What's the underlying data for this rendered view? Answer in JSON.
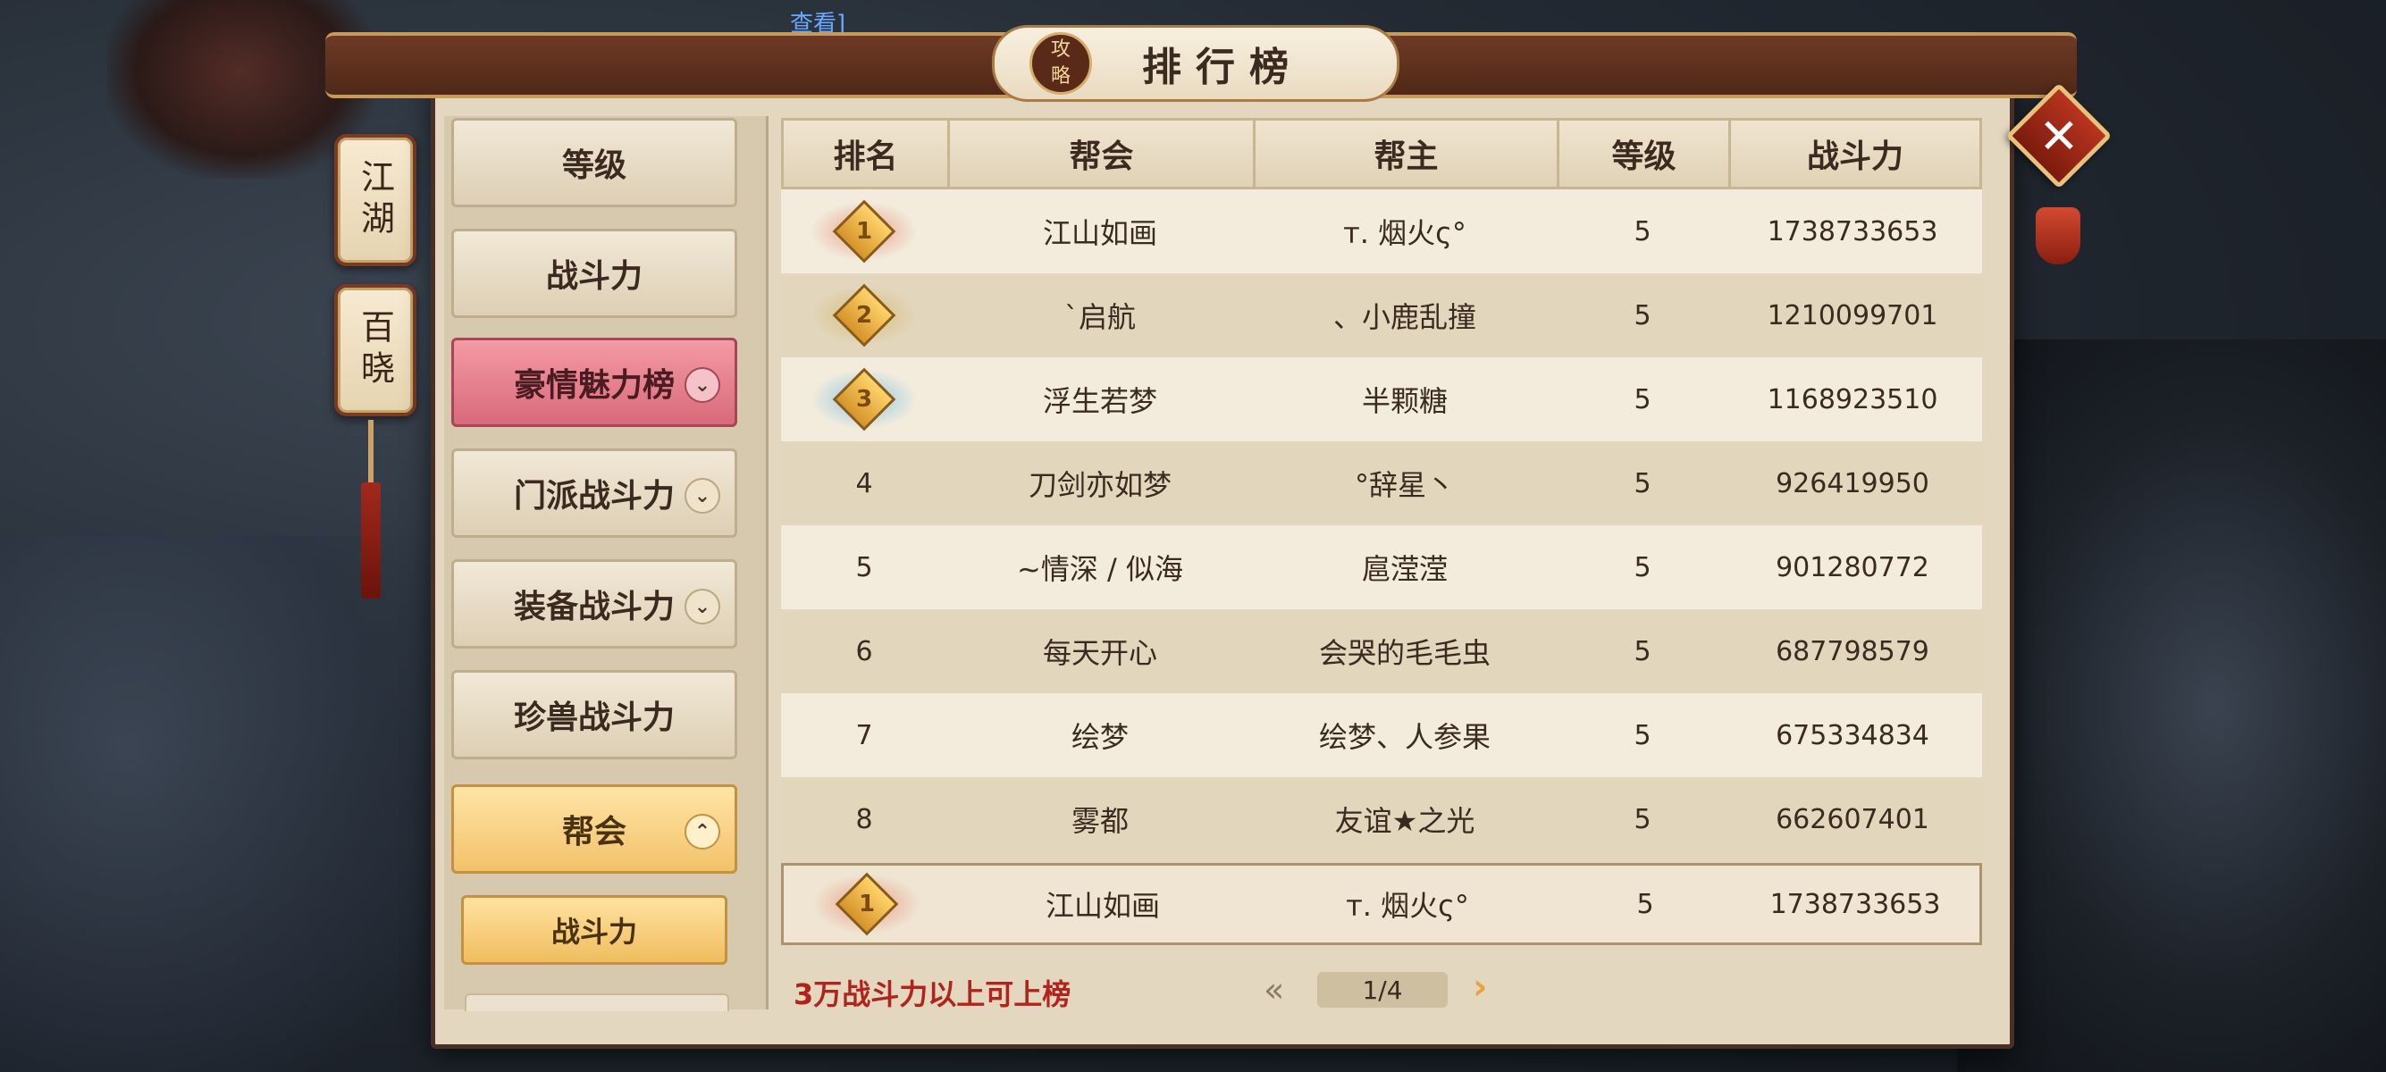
{
  "top_link": "查看]",
  "side_tabs": [
    "江湖",
    "百晓"
  ],
  "title": "排行榜",
  "title_seal": [
    "攻",
    "略"
  ],
  "close_label": "✕",
  "menu": [
    {
      "label": "等级",
      "style": "normal",
      "chevron": ""
    },
    {
      "label": "战斗力",
      "style": "normal",
      "chevron": ""
    },
    {
      "label": "豪情魅力榜",
      "style": "pink",
      "chevron": "⌄"
    },
    {
      "label": "门派战斗力",
      "style": "normal",
      "chevron": "⌄"
    },
    {
      "label": "装备战斗力",
      "style": "normal",
      "chevron": "⌄"
    },
    {
      "label": "珍兽战斗力",
      "style": "normal",
      "chevron": ""
    },
    {
      "label": "帮会",
      "style": "gold",
      "chevron": "⌃"
    }
  ],
  "submenu_selected": "战斗力",
  "table": {
    "headers": [
      "排名",
      "帮会",
      "帮主",
      "等级",
      "战斗力"
    ],
    "rows": [
      {
        "rank": "1",
        "guild": "江山如画",
        "leader": "т. 烟火ς°",
        "level": "5",
        "power": "1738733653"
      },
      {
        "rank": "2",
        "guild": "`启航",
        "leader": "、小鹿乱撞",
        "level": "5",
        "power": "1210099701"
      },
      {
        "rank": "3",
        "guild": "浮生若梦",
        "leader": "半颗糖",
        "level": "5",
        "power": "1168923510"
      },
      {
        "rank": "4",
        "guild": "刀剑亦如梦",
        "leader": "°辞星丶",
        "level": "5",
        "power": "926419950"
      },
      {
        "rank": "5",
        "guild": "~情深 / 似海",
        "leader": "扈滢滢",
        "level": "5",
        "power": "901280772"
      },
      {
        "rank": "6",
        "guild": "每天开心",
        "leader": "会哭的毛毛虫",
        "level": "5",
        "power": "687798579"
      },
      {
        "rank": "7",
        "guild": "绘梦",
        "leader": "绘梦、人参果",
        "level": "5",
        "power": "675334834"
      },
      {
        "rank": "8",
        "guild": "雾都",
        "leader": "友谊★之光",
        "level": "5",
        "power": "662607401"
      }
    ],
    "my_row": {
      "rank": "1",
      "guild": "江山如画",
      "leader": "т. 烟火ς°",
      "level": "5",
      "power": "1738733653"
    }
  },
  "footer_note": "3万战斗力以上可上榜",
  "pager": {
    "current": "1/4",
    "prev_icon": "«",
    "next_icon": "›"
  },
  "medal_colors": {
    "1": "#e8a08a",
    "2": "#d8c07a",
    "3": "#8fc8e0"
  }
}
